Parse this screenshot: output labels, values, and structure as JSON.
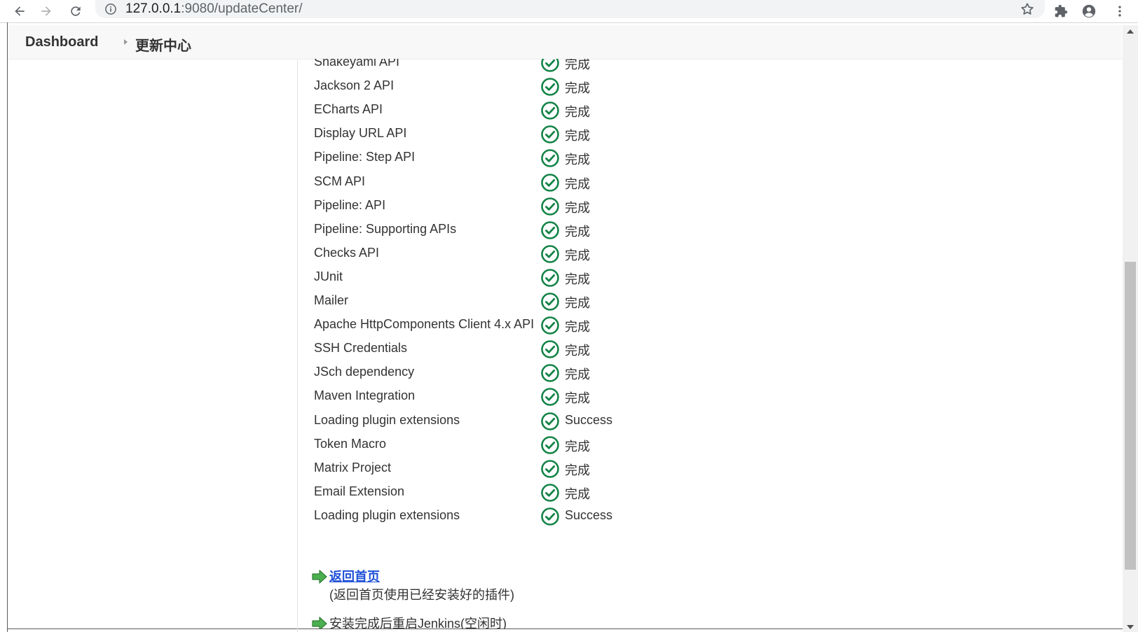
{
  "browser": {
    "url_host": "127.0.0.1",
    "url_path": ":9080/updateCenter/"
  },
  "breadcrumb": {
    "root": "Dashboard",
    "current": "更新中心"
  },
  "plugins": [
    {
      "name": "Snakeyaml API",
      "status": "完成"
    },
    {
      "name": "Jackson 2 API",
      "status": "完成"
    },
    {
      "name": "ECharts API",
      "status": "完成"
    },
    {
      "name": "Display URL API",
      "status": "完成"
    },
    {
      "name": "Pipeline: Step API",
      "status": "完成"
    },
    {
      "name": "SCM API",
      "status": "完成"
    },
    {
      "name": "Pipeline: API",
      "status": "完成"
    },
    {
      "name": "Pipeline: Supporting APIs",
      "status": "完成"
    },
    {
      "name": "Checks API",
      "status": "完成"
    },
    {
      "name": "JUnit",
      "status": "完成"
    },
    {
      "name": "Mailer",
      "status": "完成"
    },
    {
      "name": "Apache HttpComponents Client 4.x API",
      "status": "完成"
    },
    {
      "name": "SSH Credentials",
      "status": "完成"
    },
    {
      "name": "JSch dependency",
      "status": "完成"
    },
    {
      "name": "Maven Integration",
      "status": "完成"
    },
    {
      "name": "Loading plugin extensions",
      "status": "Success"
    },
    {
      "name": "Token Macro",
      "status": "完成"
    },
    {
      "name": "Matrix Project",
      "status": "完成"
    },
    {
      "name": "Email Extension",
      "status": "完成"
    },
    {
      "name": "Loading plugin extensions",
      "status": "Success"
    }
  ],
  "actions": {
    "go_home_label": "返回首页",
    "go_home_desc": "(返回首页使用已经安装好的插件)",
    "restart_label": "安装完成后重启Jenkins(空闲时)"
  },
  "colors": {
    "success_green": "#138347",
    "link_blue": "#1d4ed8",
    "arrow_green": "#4caf50"
  }
}
